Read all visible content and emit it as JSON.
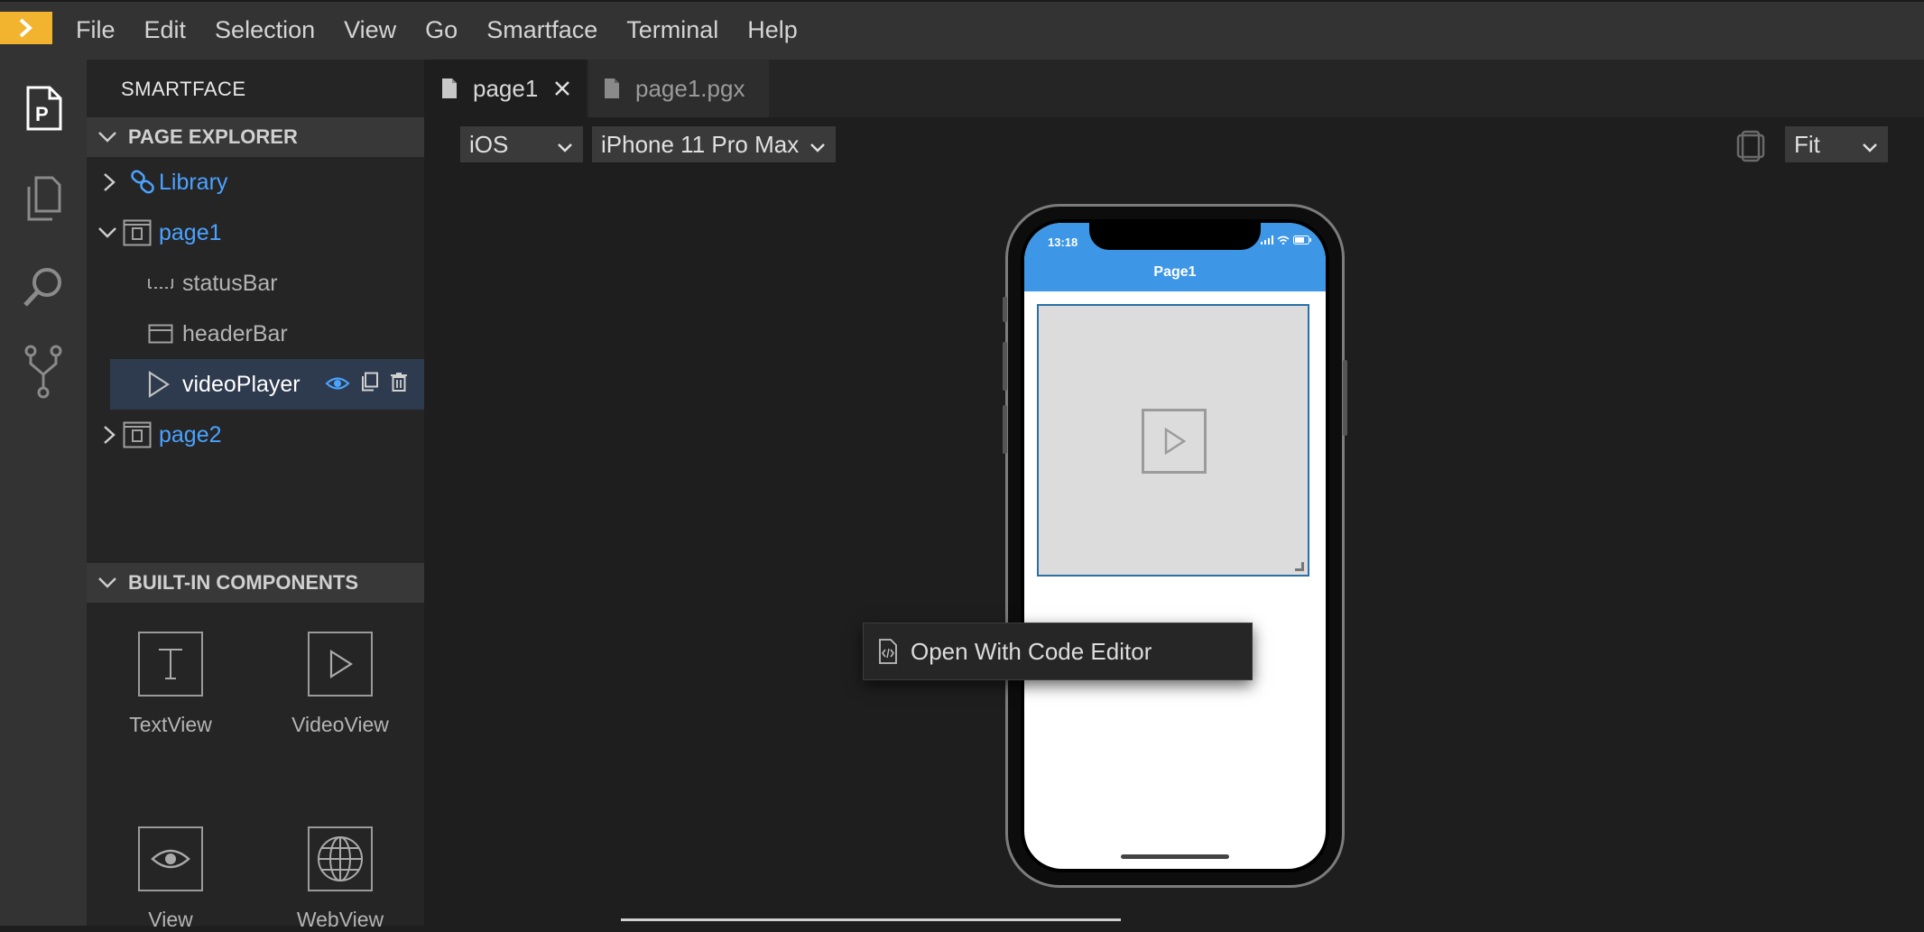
{
  "menu": {
    "items": [
      "File",
      "Edit",
      "Selection",
      "View",
      "Go",
      "Smartface",
      "Terminal",
      "Help"
    ]
  },
  "activity_bar": {
    "icons": [
      "page-explorer-icon",
      "files-icon",
      "search-icon",
      "source-control-icon"
    ]
  },
  "sidebar": {
    "title": "SMARTFACE",
    "page_explorer": {
      "header": "PAGE EXPLORER",
      "library": "Library",
      "page1": "page1",
      "status_bar": "statusBar",
      "header_bar": "headerBar",
      "video_player": "videoPlayer",
      "page2": "page2"
    },
    "built_in": {
      "header": "BUILT-IN COMPONENTS",
      "components": [
        "TextView",
        "VideoView",
        "View",
        "WebView"
      ]
    }
  },
  "tabs": {
    "page1": "page1",
    "page1_pgx": "page1.pgx"
  },
  "toolbar": {
    "platform": "iOS",
    "device": "iPhone 11 Pro Max",
    "zoom": "Fit"
  },
  "phone": {
    "status_time": "13:18",
    "header_title": "Page1"
  },
  "context_menu": {
    "item": "Open With Code Editor"
  },
  "colors": {
    "accent_blue": "#4aa3ff",
    "header_blue": "#3d96e6",
    "logo_yellow": "#f2b32f"
  }
}
